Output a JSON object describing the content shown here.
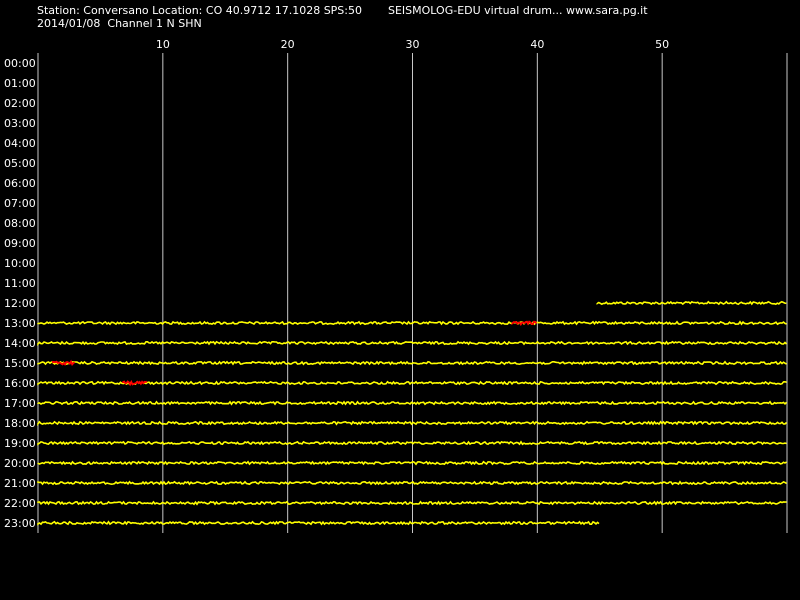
{
  "header": {
    "station_line": "Station: Conversano Location: CO 40.9712 17.1028 SPS:50",
    "date_line": "2014/01/08  Channel 1 N SHN",
    "app_line": "SEISMOLOG-EDU virtual drum... www.sara.pg.it"
  },
  "chart_data": {
    "type": "line",
    "x_unit": "minutes",
    "xlim": [
      0,
      60
    ],
    "x_ticks": [
      10,
      20,
      30,
      40,
      50
    ],
    "hours": [
      "00:00",
      "01:00",
      "02:00",
      "03:00",
      "04:00",
      "05:00",
      "06:00",
      "07:00",
      "08:00",
      "09:00",
      "10:00",
      "11:00",
      "12:00",
      "13:00",
      "14:00",
      "15:00",
      "16:00",
      "17:00",
      "18:00",
      "19:00",
      "20:00",
      "21:00",
      "22:00",
      "23:00"
    ],
    "trace_color": "#ffff00",
    "event_color": "#ff0000",
    "grid_color": "#c8c8c8",
    "traces": [
      {
        "hour": "12:00",
        "start_min": 44.8,
        "end_min": 60
      },
      {
        "hour": "13:00",
        "start_min": 0,
        "end_min": 60
      },
      {
        "hour": "14:00",
        "start_min": 0,
        "end_min": 60
      },
      {
        "hour": "15:00",
        "start_min": 0,
        "end_min": 60
      },
      {
        "hour": "16:00",
        "start_min": 0,
        "end_min": 60
      },
      {
        "hour": "17:00",
        "start_min": 0,
        "end_min": 60
      },
      {
        "hour": "18:00",
        "start_min": 0,
        "end_min": 60
      },
      {
        "hour": "19:00",
        "start_min": 0,
        "end_min": 60
      },
      {
        "hour": "20:00",
        "start_min": 0,
        "end_min": 60
      },
      {
        "hour": "21:00",
        "start_min": 0,
        "end_min": 60
      },
      {
        "hour": "22:00",
        "start_min": 0,
        "end_min": 60
      },
      {
        "hour": "23:00",
        "start_min": 0,
        "end_min": 45
      }
    ],
    "events": [
      {
        "hour": "13:00",
        "start_min": 38.0,
        "end_min": 40.0
      },
      {
        "hour": "15:00",
        "start_min": 1.2,
        "end_min": 3.0
      },
      {
        "hour": "16:00",
        "start_min": 6.8,
        "end_min": 8.8
      }
    ]
  }
}
